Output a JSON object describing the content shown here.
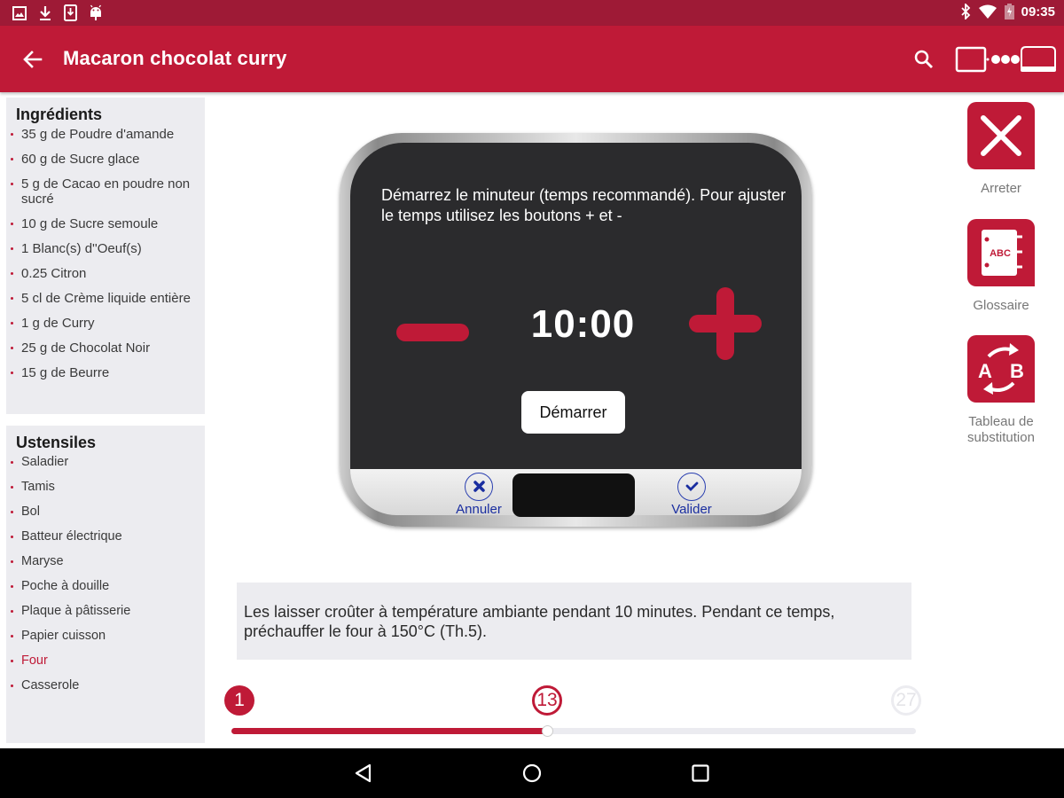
{
  "status_bar": {
    "left_icons": [
      "image-icon",
      "download-icon",
      "download-tablet-icon",
      "android-icon"
    ],
    "right_icons": [
      "bluetooth-icon",
      "wifi-icon",
      "battery-charging-icon"
    ],
    "time": "09:35"
  },
  "app_bar": {
    "title": "Macaron chocolat curry",
    "back_icon": "arrow-left-icon",
    "search_icon": "search-icon",
    "connect_icon": "tablet-to-device-icon"
  },
  "ingredients": {
    "title": "Ingrédients",
    "items": [
      "35 g de Poudre d'amande",
      "60 g de Sucre glace",
      "5 g de Cacao en poudre non sucré",
      "10 g de Sucre semoule",
      "1 Blanc(s) d''Oeuf(s)",
      "0.25 Citron",
      "5 cl de Crème liquide entière",
      "1 g de Curry",
      "25 g de Chocolat Noir",
      "15 g de Beurre"
    ]
  },
  "utensils": {
    "title": "Ustensiles",
    "items": [
      "Saladier",
      "Tamis",
      "Bol",
      "Batteur électrique",
      "Maryse",
      "Poche à douille",
      "Plaque à pâtisserie",
      "Papier cuisson",
      "Four",
      "Casserole"
    ],
    "highlighted": "Four"
  },
  "timer": {
    "instruction": "Démarrez le minuteur (temps recommandé). Pour ajuster le temps utilisez les boutons + et -",
    "value": "10:00",
    "start_label": "Démarrer",
    "cancel_label": "Annuler",
    "validate_label": "Valider"
  },
  "step": {
    "text": "Les laisser croûter à température ambiante pendant 10 minutes. Pendant ce temps, préchauffer le four à 150°C (Th.5)."
  },
  "progress": {
    "first": "1",
    "current": "13",
    "last": "27",
    "current_step": 13,
    "total_steps": 27
  },
  "side_actions": [
    {
      "label": "Arreter",
      "icon": "close-icon"
    },
    {
      "label": "Glossaire",
      "icon": "glossary-book-icon"
    },
    {
      "label": "Tableau de substitution",
      "icon": "substitution-ab-icon"
    }
  ],
  "colors": {
    "brand": "#bf1a37",
    "status_bar": "#9e1a36",
    "panel_bg": "#ececf0",
    "timer_button_blue": "#1a2ea0"
  },
  "nav_bar": {
    "icons": [
      "nav-back-icon",
      "nav-home-icon",
      "nav-recents-icon"
    ]
  }
}
